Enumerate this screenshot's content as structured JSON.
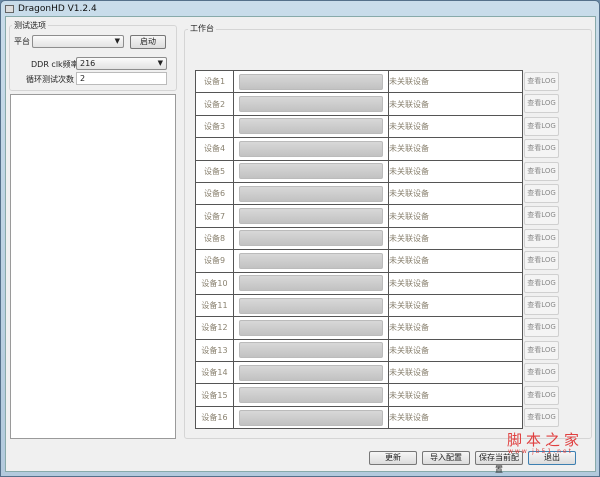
{
  "window": {
    "title": "DragonHD V1.2.4"
  },
  "test_options": {
    "group_label": "测试选项",
    "platform_label": "平台",
    "platform_value": "",
    "start_button": "启动",
    "ddr_label": "DDR clk频率",
    "ddr_value": "216",
    "loop_label": "循环测试次数",
    "loop_value": "2"
  },
  "workbench": {
    "group_label": "工作台",
    "devices": [
      {
        "name": "设备1",
        "status": "未关联设备",
        "log": "查看LOG"
      },
      {
        "name": "设备2",
        "status": "未关联设备",
        "log": "查看LOG"
      },
      {
        "name": "设备3",
        "status": "未关联设备",
        "log": "查看LOG"
      },
      {
        "name": "设备4",
        "status": "未关联设备",
        "log": "查看LOG"
      },
      {
        "name": "设备5",
        "status": "未关联设备",
        "log": "查看LOG"
      },
      {
        "name": "设备6",
        "status": "未关联设备",
        "log": "查看LOG"
      },
      {
        "name": "设备7",
        "status": "未关联设备",
        "log": "查看LOG"
      },
      {
        "name": "设备8",
        "status": "未关联设备",
        "log": "查看LOG"
      },
      {
        "name": "设备9",
        "status": "未关联设备",
        "log": "查看LOG"
      },
      {
        "name": "设备10",
        "status": "未关联设备",
        "log": "查看LOG"
      },
      {
        "name": "设备11",
        "status": "未关联设备",
        "log": "查看LOG"
      },
      {
        "name": "设备12",
        "status": "未关联设备",
        "log": "查看LOG"
      },
      {
        "name": "设备13",
        "status": "未关联设备",
        "log": "查看LOG"
      },
      {
        "name": "设备14",
        "status": "未关联设备",
        "log": "查看LOG"
      },
      {
        "name": "设备15",
        "status": "未关联设备",
        "log": "查看LOG"
      },
      {
        "name": "设备16",
        "status": "未关联设备",
        "log": "查看LOG"
      }
    ]
  },
  "footer": {
    "update": "更新",
    "import": "导入配置",
    "save": "保存当前配置",
    "exit": "退出"
  },
  "watermark": {
    "text": "脚本之家",
    "url": "www.jb51.net"
  }
}
